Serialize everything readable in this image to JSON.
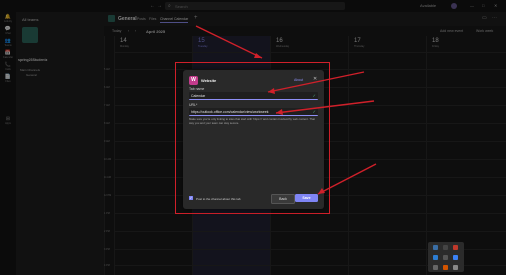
{
  "titlebar": {
    "back": "←",
    "forward": "→",
    "search_placeholder": "Search",
    "status": "Available",
    "minimize": "—",
    "maximize": "□",
    "close": "✕"
  },
  "rail": [
    {
      "icon": "activity-icon",
      "glyph": "🔔",
      "label": "Activity"
    },
    {
      "icon": "chat-icon",
      "glyph": "💬",
      "label": "Chat"
    },
    {
      "icon": "teams-icon",
      "glyph": "👥",
      "label": "Teams"
    },
    {
      "icon": "calendar-icon",
      "glyph": "📅",
      "label": "Calendar"
    },
    {
      "icon": "calls-icon",
      "glyph": "📞",
      "label": "Calls"
    },
    {
      "icon": "files-icon",
      "glyph": "📄",
      "label": "Files"
    },
    {
      "icon": "apps-icon",
      "glyph": "⊞",
      "label": "Apps"
    }
  ],
  "leftpanel": {
    "title": "All teams",
    "team_name": "spring23Studentz",
    "channels_header": "Main Channels",
    "channel": "General"
  },
  "channelbar": {
    "name": "General",
    "tabs": [
      "Posts",
      "Files",
      "Channel Calendar"
    ],
    "plus": "+"
  },
  "calendar": {
    "today_btn": "Today",
    "month": "April 2025",
    "add_event": "Add new event",
    "view": "Work week",
    "days": [
      {
        "num": "14",
        "name": "Monday"
      },
      {
        "num": "15",
        "name": "Tuesday"
      },
      {
        "num": "16",
        "name": "Wednesday"
      },
      {
        "num": "17",
        "name": "Thursday"
      },
      {
        "num": "18",
        "name": "Friday"
      }
    ],
    "times": [
      "5 AM",
      "6 AM",
      "7 AM",
      "8 AM",
      "9 AM",
      "10 AM",
      "11 AM",
      "12 PM",
      "1 PM",
      "2 PM",
      "3 PM",
      "4 PM"
    ]
  },
  "dialog": {
    "logo": "W",
    "title": "Website",
    "about": "About",
    "close": "✕",
    "tab_name_label": "Tab name",
    "tab_name_value": "Calendar",
    "url_label": "URL*",
    "url_value": "https://outlook.office.com/calendar/view/workweek",
    "hint": "Make sure you're only linking to sites that start with 'https://' and contain trustworthy web content. That way you and your team can stay secure.",
    "post_label": "Post to the channel about this tab",
    "back": "Back",
    "save": "Save"
  },
  "colors": {
    "accent": "#7f85f5",
    "callout": "#d0202a",
    "team": "#2f6b5f"
  }
}
